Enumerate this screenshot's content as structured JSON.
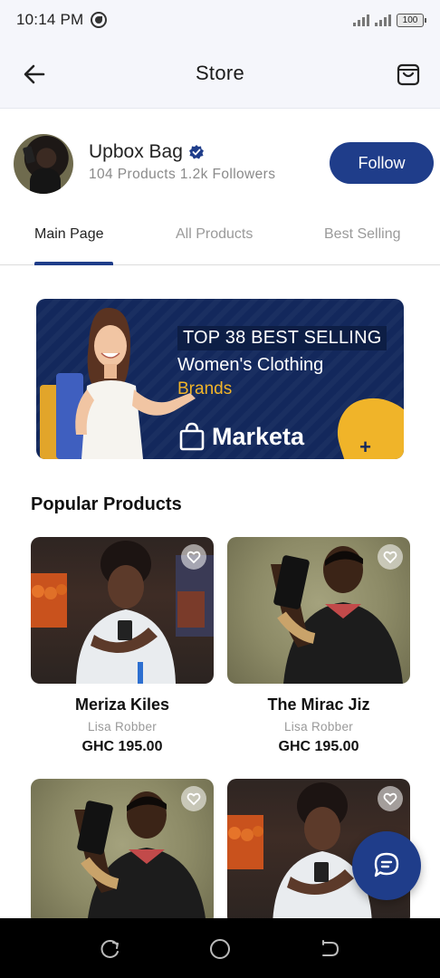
{
  "status_bar": {
    "time": "10:14 PM",
    "battery": "100"
  },
  "header": {
    "title": "Store"
  },
  "store": {
    "name": "Upbox Bag",
    "products_count": "104 Products",
    "followers": "1.2k Followers",
    "follow_label": "Follow"
  },
  "tabs": [
    {
      "label": "Main Page",
      "active": true
    },
    {
      "label": "All Products",
      "active": false
    },
    {
      "label": "Best Selling",
      "active": false
    }
  ],
  "banner": {
    "line1": "TOP 38 BEST SELLING",
    "line2": "Women's Clothing",
    "line3": "Brands",
    "brand": "Marketa",
    "plus": "+"
  },
  "section": {
    "title": "Popular Products"
  },
  "products": [
    {
      "name": "Meriza Kiles",
      "seller": "Lisa Robber",
      "price": "GHC 195.00",
      "image": "market"
    },
    {
      "name": "The Mirac Jiz",
      "seller": "Lisa Robber",
      "price": "GHC 195.00",
      "image": "studio"
    },
    {
      "name": "",
      "seller": "",
      "price": "",
      "image": "studio"
    },
    {
      "name": "",
      "seller": "",
      "price": "",
      "image": "market"
    }
  ],
  "colors": {
    "primary": "#1f3d8a",
    "accent": "#f0b429",
    "banner_bg": "#13285c"
  },
  "icons": {
    "back": "arrow-left-icon",
    "cart": "shopping-bag-icon",
    "verified": "verified-badge-icon",
    "favorite": "heart-icon",
    "chat": "chat-bubble-icon"
  }
}
